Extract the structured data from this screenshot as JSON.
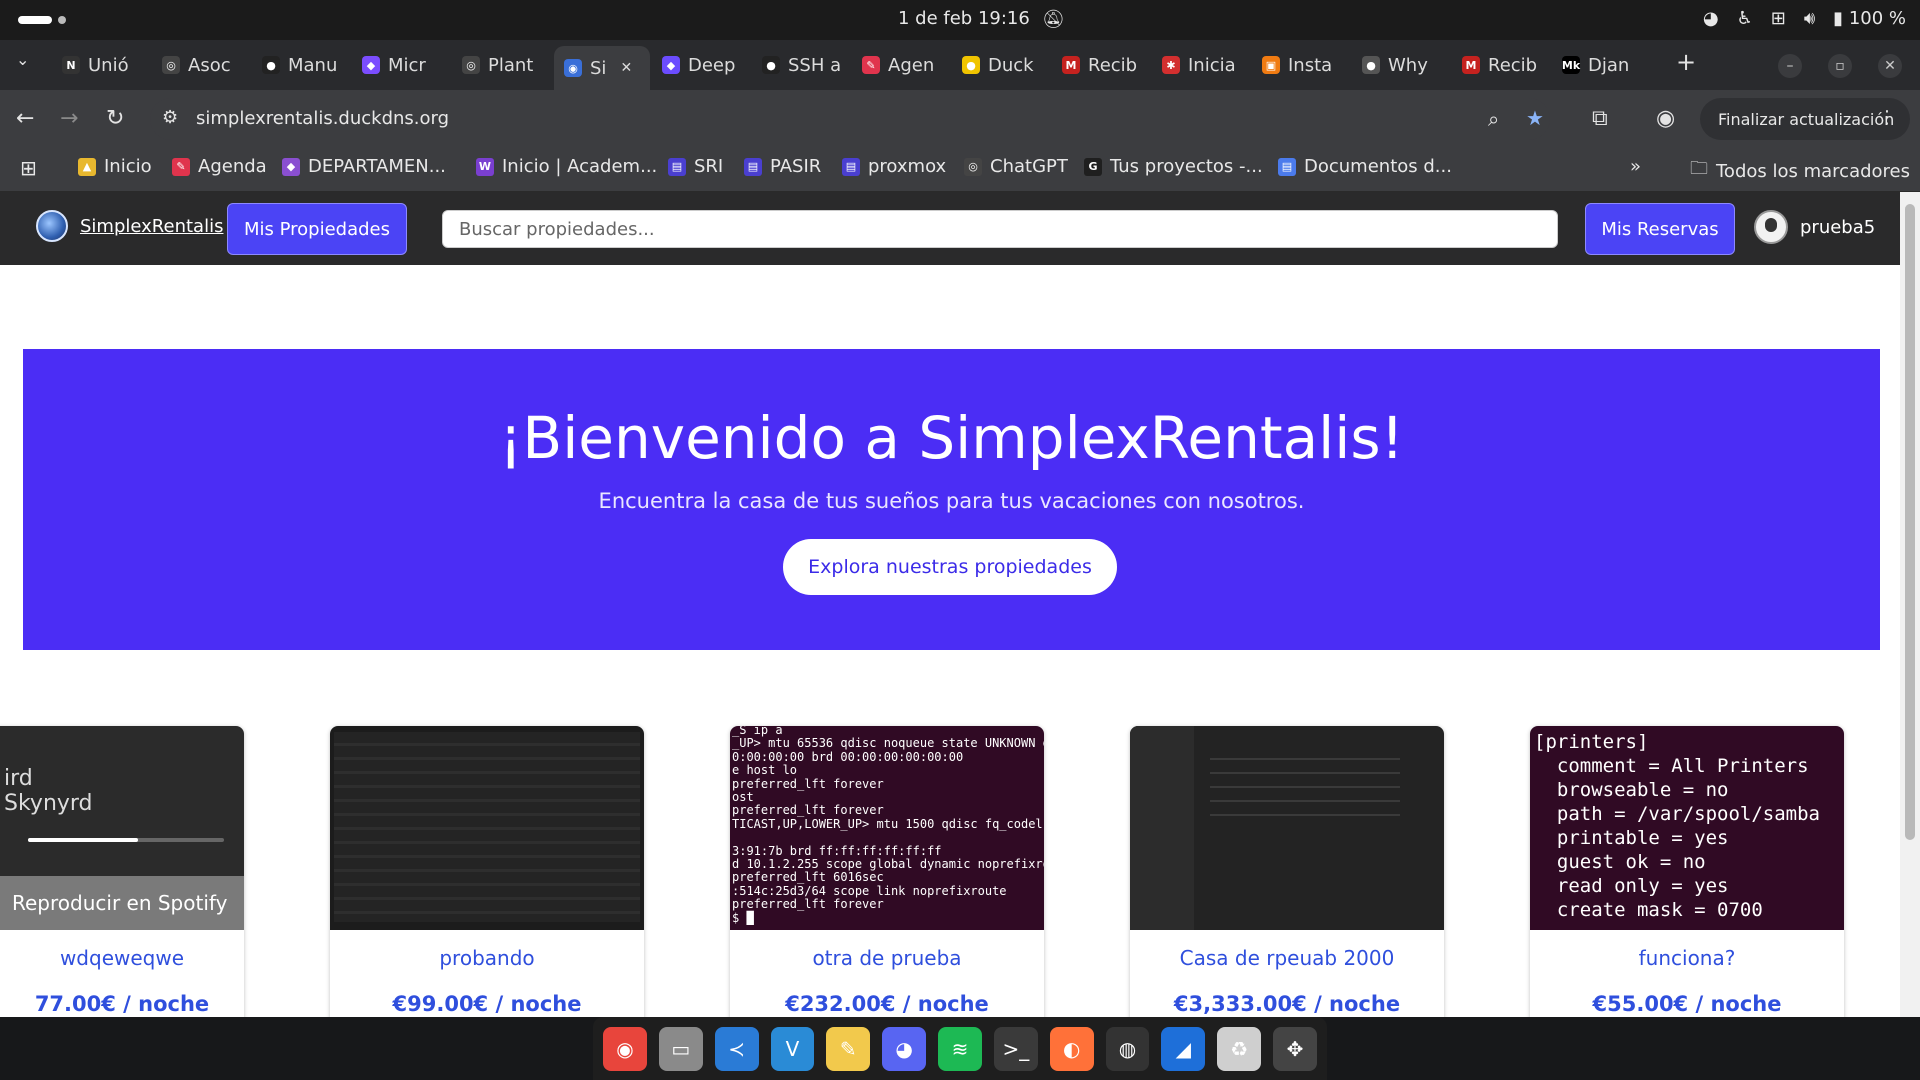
{
  "system": {
    "clock": "1 de feb  19:16",
    "battery": "100 %"
  },
  "tabs": [
    {
      "label": "Unió",
      "favicon": "N",
      "color": "#333333"
    },
    {
      "label": "Asoc",
      "favicon": "◎",
      "color": "#444444"
    },
    {
      "label": "Manu",
      "favicon": "●",
      "color": "#222222"
    },
    {
      "label": "Micr",
      "favicon": "◆",
      "color": "#7b4dff"
    },
    {
      "label": "Plant",
      "favicon": "◎",
      "color": "#444444"
    },
    {
      "label": "Si",
      "favicon": "◉",
      "color": "#3a6fd8"
    },
    {
      "label": "Deep",
      "favicon": "◆",
      "color": "#6b4cff"
    },
    {
      "label": "SSH a",
      "favicon": "●",
      "color": "#222222"
    },
    {
      "label": "Agen",
      "favicon": "✎",
      "color": "#e0344d"
    },
    {
      "label": "Duck",
      "favicon": "●",
      "color": "#f0c400"
    },
    {
      "label": "Recib",
      "favicon": "M",
      "color": "#c5221f"
    },
    {
      "label": "Inicia",
      "favicon": "✱",
      "color": "#d32f2f"
    },
    {
      "label": "Insta",
      "favicon": "▣",
      "color": "#f07b12"
    },
    {
      "label": "Why",
      "favicon": "●",
      "color": "#555555"
    },
    {
      "label": "Recib",
      "favicon": "M",
      "color": "#c5221f"
    },
    {
      "label": "Djan",
      "favicon": "Mk",
      "color": "#000000"
    }
  ],
  "address": {
    "url": "simplexrentalis.duckdns.org",
    "update_label": "Finalizar actualización"
  },
  "bookmarks": [
    {
      "label": "Inicio",
      "icon": "▲",
      "color": "#e8b82f"
    },
    {
      "label": "Agenda",
      "icon": "✎",
      "color": "#e0344d"
    },
    {
      "label": "DEPARTAMEN...",
      "icon": "◆",
      "color": "#8a4fd1"
    },
    {
      "label": "Inicio | Academ...",
      "icon": "W",
      "color": "#7a3fd0"
    },
    {
      "label": "SRI",
      "icon": "▤",
      "color": "#4a3fd0"
    },
    {
      "label": "PASIR",
      "icon": "▤",
      "color": "#4a3fd0"
    },
    {
      "label": "proxmox",
      "icon": "▤",
      "color": "#4a3fd0"
    },
    {
      "label": "ChatGPT",
      "icon": "◎",
      "color": "#444444"
    },
    {
      "label": "Tus proyectos -...",
      "icon": "G",
      "color": "#1f1f1f"
    },
    {
      "label": "Documentos d...",
      "icon": "▤",
      "color": "#4b7bec"
    }
  ],
  "bookmarks_all": "Todos los marcadores",
  "site": {
    "brand": "SimplexRentalis",
    "my_properties": "Mis Propiedades",
    "search_placeholder": "Buscar propiedades...",
    "my_bookings": "Mis Reservas",
    "username": "prueba5"
  },
  "hero": {
    "title": "¡Bienvenido a SimplexRentalis!",
    "subtitle": "Encuentra la casa de tus sueños para tus vacaciones con nosotros.",
    "cta": "Explora nuestras propiedades"
  },
  "properties": [
    {
      "title": "wdqeweqwe",
      "price": "77.00€ / noche",
      "image_text": "ird\nSkynyrd",
      "image_button": "Reproducir en Spotify"
    },
    {
      "title": "probando",
      "price": "€99.00€ / noche"
    },
    {
      "title": "otra de prueba",
      "price": "€232.00€ / noche",
      "image_text": "_S ip a\n_UP> mtu 65536 qdisc noqueue state UNKNOWN grou\n0:00:00:00 brd 00:00:00:00:00:00\ne host lo\npreferred_lft forever\nost\npreferred_lft forever\nTICAST,UP,LOWER_UP> mtu 1500 qdisc fq_codel sta\n\n3:91:7b brd ff:ff:ff:ff:ff:ff\nd 10.1.2.255 scope global dynamic noprefixroute\npreferred_lft 6016sec\n:514c:25d3/64 scope link noprefixroute\npreferred_lft forever\n$ █"
    },
    {
      "title": "Casa de rpeuab 2000",
      "price": "€3,333.00€ / noche"
    },
    {
      "title": "funciona?",
      "price": "€55.00€ / noche",
      "image_text": "[printers]\n  comment = All Printers\n  browseable = no\n  path = /var/spool/samba\n  printable = yes\n  guest ok = no\n  read only = yes\n  create mask = 0700"
    }
  ],
  "dock": [
    {
      "name": "chrome",
      "glyph": "◉",
      "color": "#e8453c"
    },
    {
      "name": "files",
      "glyph": "▭",
      "color": "#8a8a8a"
    },
    {
      "name": "vscode",
      "glyph": "≺",
      "color": "#2a7bd6"
    },
    {
      "name": "editor",
      "glyph": "V",
      "color": "#2a8bd6"
    },
    {
      "name": "notes",
      "glyph": "✎",
      "color": "#f2c94c"
    },
    {
      "name": "discord",
      "glyph": "◕",
      "color": "#5865f2"
    },
    {
      "name": "spotify",
      "glyph": "≋",
      "color": "#1db954"
    },
    {
      "name": "terminal",
      "glyph": ">_",
      "color": "#3a3a3a"
    },
    {
      "name": "firefox",
      "glyph": "◐",
      "color": "#ff7139"
    },
    {
      "name": "obs",
      "glyph": "◍",
      "color": "#333333"
    },
    {
      "name": "wireshark",
      "glyph": "◢",
      "color": "#1e6fd9"
    },
    {
      "name": "trash",
      "glyph": "♻",
      "color": "#cfcfcf"
    },
    {
      "name": "apps",
      "glyph": "✥",
      "color": "#444444"
    }
  ]
}
